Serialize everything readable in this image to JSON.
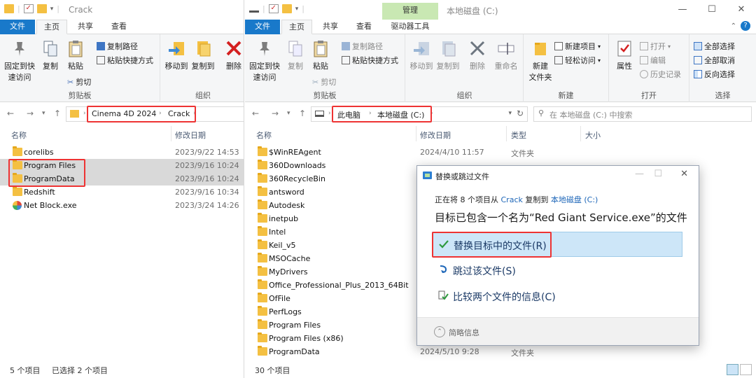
{
  "left": {
    "title": "Crack",
    "tabs": [
      "文件",
      "主页",
      "共享",
      "查看"
    ],
    "ribbon": {
      "pin": "固定到快\n速访问",
      "copy": "复制",
      "paste": "粘贴",
      "copy_path": "复制路径",
      "paste_shortcut": "粘贴快捷方式",
      "cut": "剪切",
      "clipboard_group": "剪贴板",
      "move_to": "移动到",
      "copy_to": "复制到",
      "delete": "删除",
      "organize_group": "组织"
    },
    "breadcrumb": [
      "Cinema 4D 2024",
      "Crack"
    ],
    "columns": {
      "name": "名称",
      "date": "修改日期"
    },
    "files": [
      {
        "name": "corelibs",
        "date": "2023/9/22 14:53",
        "selected": false,
        "kind": "folder"
      },
      {
        "name": "Program Files",
        "date": "2023/9/16 10:24",
        "selected": true,
        "kind": "folder"
      },
      {
        "name": "ProgramData",
        "date": "2023/9/16 10:24",
        "selected": true,
        "kind": "folder"
      },
      {
        "name": "Redshift",
        "date": "2023/9/16 10:34",
        "selected": false,
        "kind": "folder"
      },
      {
        "name": "Net Block.exe",
        "date": "2023/3/24 14:26",
        "selected": false,
        "kind": "exe"
      }
    ],
    "status_count": "5 个项目",
    "status_selected": "已选择 2 个项目"
  },
  "right": {
    "title": "本地磁盘 (C:)",
    "context_tab": "管理",
    "context_subtab": "驱动器工具",
    "tabs": [
      "文件",
      "主页",
      "共享",
      "查看"
    ],
    "ribbon": {
      "pin": "固定到快\n速访问",
      "copy": "复制",
      "paste": "粘贴",
      "copy_path": "复制路径",
      "paste_shortcut": "粘贴快捷方式",
      "cut": "剪切",
      "clipboard_group": "剪贴板",
      "move_to": "移动到",
      "copy_to": "复制到",
      "delete": "删除",
      "rename": "重命名",
      "organize_group": "组织",
      "new_item": "新建项目",
      "easy_access": "轻松访问",
      "new_folder": "新建\n文件夹",
      "new_group": "新建",
      "properties": "属性",
      "open": "打开",
      "edit": "编辑",
      "history": "历史记录",
      "open_group": "打开",
      "select_all": "全部选择",
      "select_none": "全部取消",
      "invert": "反向选择",
      "select_group": "选择"
    },
    "breadcrumb": [
      "此电脑",
      "本地磁盘 (C:)"
    ],
    "search_placeholder": "在 本地磁盘 (C:) 中搜索",
    "columns": {
      "name": "名称",
      "date": "修改日期",
      "type": "类型",
      "size": "大小"
    },
    "files": [
      {
        "name": "$WinREAgent",
        "date": "2024/4/10 11:57",
        "type": "文件夹"
      },
      {
        "name": "360Downloads",
        "date": "",
        "type": ""
      },
      {
        "name": "360RecycleBin",
        "date": "",
        "type": ""
      },
      {
        "name": "antsword",
        "date": "",
        "type": ""
      },
      {
        "name": "Autodesk",
        "date": "",
        "type": ""
      },
      {
        "name": "inetpub",
        "date": "",
        "type": ""
      },
      {
        "name": "Intel",
        "date": "",
        "type": ""
      },
      {
        "name": "Keil_v5",
        "date": "",
        "type": ""
      },
      {
        "name": "MSOCache",
        "date": "",
        "type": ""
      },
      {
        "name": "MyDrivers",
        "date": "",
        "type": ""
      },
      {
        "name": "Office_Professional_Plus_2013_64Bit",
        "date": "",
        "type": ""
      },
      {
        "name": "OfFile",
        "date": "",
        "type": ""
      },
      {
        "name": "PerfLogs",
        "date": "",
        "type": ""
      },
      {
        "name": "Program Files",
        "date": "",
        "type": ""
      },
      {
        "name": "Program Files (x86)",
        "date": "",
        "type": ""
      },
      {
        "name": "ProgramData",
        "date": "2024/5/10 9:28",
        "type": "文件夹"
      }
    ],
    "status_count": "30 个项目"
  },
  "dialog": {
    "title": "替换或跳过文件",
    "info_prefix": "正在将 8 个项目从",
    "info_src": "Crack",
    "info_mid": "复制到",
    "info_dst": "本地磁盘 (C:)",
    "headline": "目标已包含一个名为“Red Giant Service.exe”的文件",
    "opt_replace": "替换目标中的文件(R)",
    "opt_skip": "跳过该文件(S)",
    "opt_compare": "比较两个文件的信息(C)",
    "footer": "简略信息"
  },
  "colors": {
    "accent": "#1979ca",
    "highlight_red": "#e33333",
    "folder": "#f4c042",
    "option_hl": "#cde6f8"
  }
}
